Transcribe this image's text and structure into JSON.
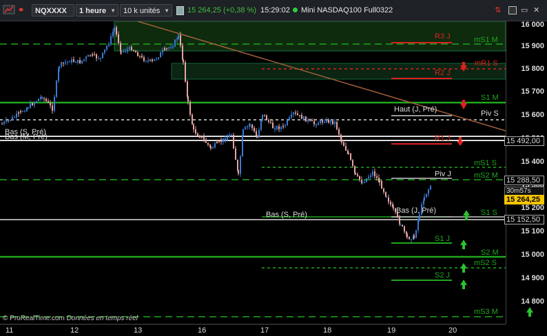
{
  "toolbar": {
    "symbol": "NQXXXX",
    "timeframe": "1 heure",
    "units": "10 k unités",
    "price": "15 264,25 (+0,38 %)",
    "time": "15:29:02",
    "instrument": "Mini NASDAQ100 Full0322"
  },
  "y_axis_labels": [
    "16 000",
    "15 900",
    "15 800",
    "15 700",
    "15 600",
    "15 500",
    "15 400",
    "15 300",
    "15 200",
    "15 100",
    "15 000",
    "14 900",
    "14 800"
  ],
  "x_axis_labels": [
    "11",
    "12",
    "13",
    "16",
    "17",
    "18",
    "19",
    "20"
  ],
  "price_boxes": {
    "p1": "15 492,00",
    "p2": "15 288,50",
    "timer": "30m57s",
    "current": "15 264,25",
    "p3": "15 152,50"
  },
  "levels": {
    "r3j": "R3 J",
    "ms1m": "mS1 M",
    "mr1s": "mR1 S",
    "r2j": "R2 J",
    "s1m": "S1 M",
    "hautj": "Haut (J, Pré)",
    "pivs": "Piv S",
    "bass": "Bas (S, Pré)",
    "basm": "Bas (M, Pré)",
    "r1j": "R1 J",
    "ms1s": "mS1 S",
    "pivj": "Piv J",
    "s2m": "mS2 M",
    "bass2": "Bas (S, Pré)",
    "basj": "Bas (J, Pré)",
    "s1s": "S1 S",
    "s1j": "S1 J",
    "s2m2": "S2 M",
    "ms2s": "mS2 S",
    "s2j": "S2 J",
    "ms3m": "mS3 M"
  },
  "copyright": "© ProRealTime.com",
  "realtime_note": "Données en temps réel",
  "colors": {
    "up": "#3a7bd5",
    "down": "#e8a5a5",
    "green": "#1fa81f",
    "red": "#e02020"
  }
}
